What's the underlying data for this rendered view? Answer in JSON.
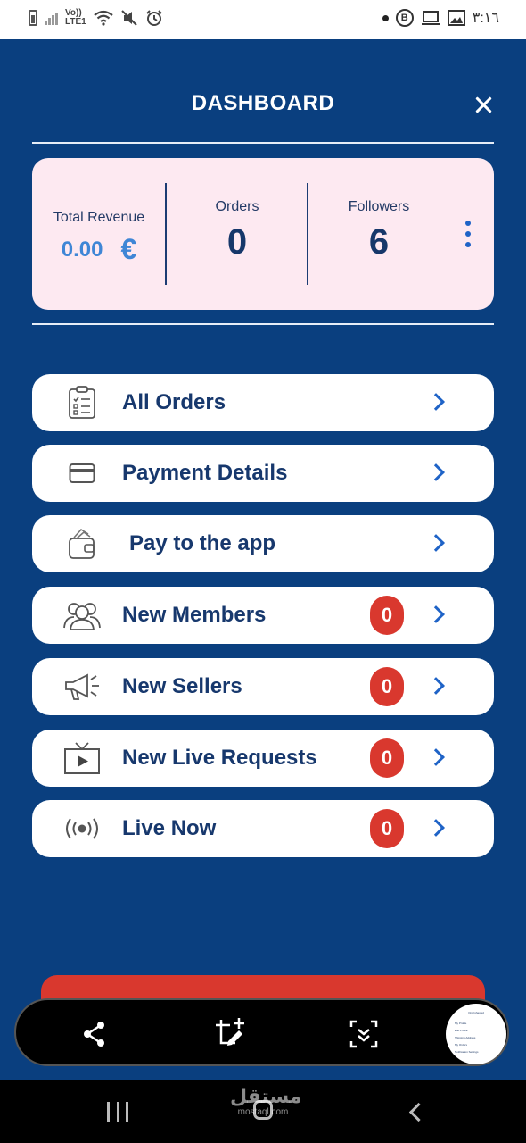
{
  "status_bar": {
    "network_top": "Vo))",
    "network_bottom": "LTE1",
    "time": "٣:١٦",
    "b_badge": "B"
  },
  "header": {
    "title": "DASHBOARD"
  },
  "stats": {
    "revenue_label": "Total Revenue",
    "revenue_value": "0.00",
    "currency": "€",
    "orders_label": "Orders",
    "orders_value": "0",
    "followers_label": "Followers",
    "followers_value": "6"
  },
  "menu": [
    {
      "label": "All Orders",
      "icon": "clipboard-list-icon"
    },
    {
      "label": "Payment Details",
      "icon": "credit-card-icon"
    },
    {
      "label": "Pay to the app",
      "icon": "wallet-icon"
    },
    {
      "label": "New Members",
      "icon": "users-icon",
      "badge": "0"
    },
    {
      "label": "New Sellers",
      "icon": "megaphone-icon",
      "badge": "0"
    },
    {
      "label": "New Live Requests",
      "icon": "tv-play-icon",
      "badge": "0"
    },
    {
      "label": "Live Now",
      "icon": "broadcast-icon",
      "badge": "0"
    }
  ],
  "toolbar": {
    "icons": [
      "share-icon",
      "crop-edit-icon",
      "scroll-capture-icon"
    ]
  },
  "thumbnail": {
    "lines": [
      "Ons Ishaq ed",
      "My Profile",
      "Edit Profile",
      "Shipping Address",
      "My Orders",
      "Notification Settings"
    ]
  },
  "watermark": {
    "main": "مستقل",
    "sub": "mostaql.com"
  },
  "colors": {
    "background": "#0a3f7f",
    "card": "#fde9f1",
    "accent_blue": "#1f63c7",
    "badge_red": "#d9382e",
    "text_navy": "#17386d"
  }
}
